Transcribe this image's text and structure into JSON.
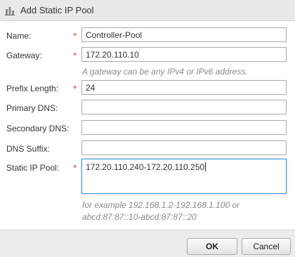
{
  "dialog": {
    "title": "Add Static IP Pool",
    "icon": "ip-pool-icon"
  },
  "form": {
    "name": {
      "label": "Name:",
      "value": "Controller-Pool",
      "required": true
    },
    "gateway": {
      "label": "Gateway:",
      "value": "172.20.110.10",
      "required": true,
      "hint": "A gateway can be any IPv4 or IPv6 address."
    },
    "prefix_length": {
      "label": "Prefix Length:",
      "value": "24",
      "required": true
    },
    "primary_dns": {
      "label": "Primary DNS:",
      "value": ""
    },
    "secondary_dns": {
      "label": "Secondary DNS:",
      "value": ""
    },
    "dns_suffix": {
      "label": "DNS Suffix:",
      "value": ""
    },
    "static_ip_pool": {
      "label": "Static IP Pool:",
      "value": "172.20.110.240-172.20.110.250",
      "required": true,
      "hint_line1": "for example 192.168.1.2-192.168.1.100 or",
      "hint_line2": "abcd:87:87::10-abcd:87:87::20"
    }
  },
  "required_marker": "*",
  "buttons": {
    "ok": "OK",
    "cancel": "Cancel"
  },
  "colors": {
    "required": "#d9534f",
    "focus_border": "#4a9bd8",
    "hint": "#8a8a8a"
  }
}
